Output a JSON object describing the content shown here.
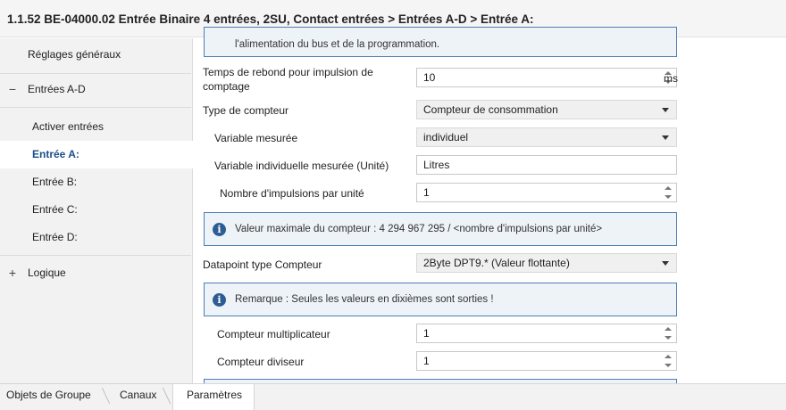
{
  "title": "1.1.52 BE-04000.02 Entrée Binaire 4 entrées, 2SU, Contact entrées > Entrées A-D > Entrée A:",
  "sidebar": {
    "items": [
      {
        "label": "Réglages généraux"
      },
      {
        "label": "Entrées A-D",
        "sign": "−"
      },
      {
        "label": "Activer entrées"
      },
      {
        "label": "Entrée A:"
      },
      {
        "label": "Entrée B:"
      },
      {
        "label": "Entrée C:"
      },
      {
        "label": "Entrée D:"
      },
      {
        "label": "Logique",
        "sign": "+"
      }
    ]
  },
  "main": {
    "top_note": "l'alimentation du bus et de la programmation.",
    "rebond": {
      "label_line1": "Temps de rebond pour impulsion de",
      "label_line2": "comptage",
      "value": "10",
      "unit": "ms"
    },
    "type_compteur": {
      "label": "Type de compteur",
      "value": "Compteur de consommation"
    },
    "variable_mesuree": {
      "label": "Variable mesurée",
      "value": "individuel"
    },
    "variable_indiv": {
      "label": "Variable individuelle mesurée (Unité)",
      "value": "Litres"
    },
    "impulsions": {
      "label": "Nombre d'impulsions par unité",
      "value": "1"
    },
    "info_max": "Valeur maximale du compteur : 4 294 967 295 / <nombre d'impulsions par unité>",
    "datapoint": {
      "label": "Datapoint type Compteur",
      "value": "2Byte DPT9.* (Valeur flottante)"
    },
    "remarque": "Remarque : Seules les valeurs en dixièmes sont sorties !",
    "multiplicateur": {
      "label": "Compteur multiplicateur",
      "value": "1"
    },
    "diviseur": {
      "label": "Compteur diviseur",
      "value": "1"
    }
  },
  "tabs": [
    {
      "label": "Objets de Groupe"
    },
    {
      "label": "Canaux"
    },
    {
      "label": "Paramètres",
      "active": true
    }
  ],
  "icons": {
    "info": "info-icon",
    "dropdown": "chevron-down-icon",
    "spinner": "spinner-icon"
  },
  "colors": {
    "accent": "#1a4f8a",
    "info_border": "#4a7fb5",
    "info_bg": "#eef3f8"
  }
}
